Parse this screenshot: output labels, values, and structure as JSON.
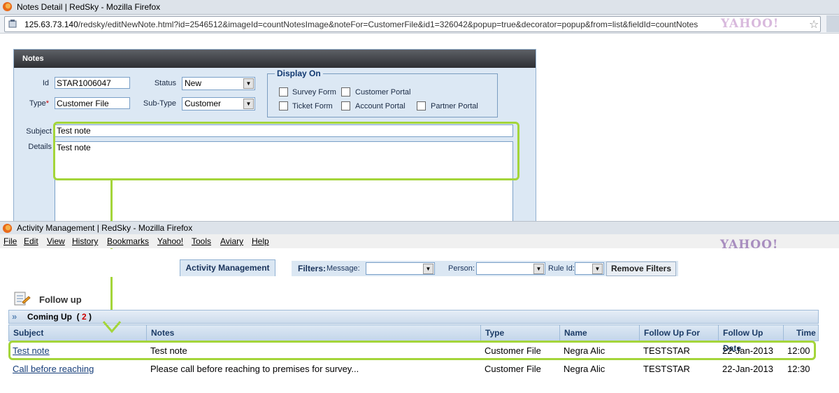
{
  "window1": {
    "title": "Notes Detail | RedSky - Mozilla Firefox",
    "url_host": "125.63.73.140",
    "url_path": "/redsky/editNewNote.html?id=2546512&imageId=countNotesImage&noteFor=CustomerFile&id1=326042&popup=true&decorator=popup&from=list&fieldId=countNotes",
    "search_brand": "YAHOO!",
    "panel_title": "Notes",
    "fields": {
      "id_label": "Id",
      "id_value": "STAR1006047",
      "type_label": "Type",
      "type_value": "Customer File",
      "status_label": "Status",
      "status_value": "New",
      "subtype_label": "Sub-Type",
      "subtype_value": "Customer",
      "subject_label": "Subject",
      "subject_value": "Test note",
      "details_label": "Details",
      "details_value": "Test note"
    },
    "display_on": {
      "legend": "Display On",
      "options": [
        "Survey Form",
        "Customer Portal",
        "Ticket Form",
        "Account Portal",
        "Partner Portal"
      ]
    }
  },
  "window2": {
    "title": "Activity Management | RedSky - Mozilla Firefox",
    "menu": [
      "File",
      "Edit",
      "View",
      "History",
      "Bookmarks",
      "Yahoo!",
      "Tools",
      "Aviary",
      "Help"
    ],
    "search_brand": "YAHOO!",
    "tab_label": "Activity Management",
    "filters": {
      "label": "Filters:",
      "message_label": "Message:",
      "person_label": "Person:",
      "rule_label": "Rule Id:",
      "remove_label": "Remove Filters"
    },
    "section_title": "Follow up",
    "coming_up_label": "Coming Up",
    "coming_up_count": "2",
    "columns": [
      "Subject",
      "Notes",
      "Type",
      "Name",
      "Follow Up For",
      "Follow Up Date",
      "Time"
    ],
    "rows": [
      {
        "subject": "Test note",
        "notes": "Test note",
        "type": "Customer File",
        "name": "Negra Alic",
        "follow_up_for": "TESTSTAR",
        "date": "22-Jan-2013",
        "time": "12:00"
      },
      {
        "subject": "Call before reaching",
        "notes": "Please call before reaching to premises for survey...",
        "type": "Customer File",
        "name": "Negra Alic",
        "follow_up_for": "TESTSTAR",
        "date": "22-Jan-2013",
        "time": "12:30"
      }
    ]
  },
  "colors": {
    "highlight": "#a4d53a",
    "panel_bg": "#dce8f4",
    "link": "#173f7a"
  }
}
